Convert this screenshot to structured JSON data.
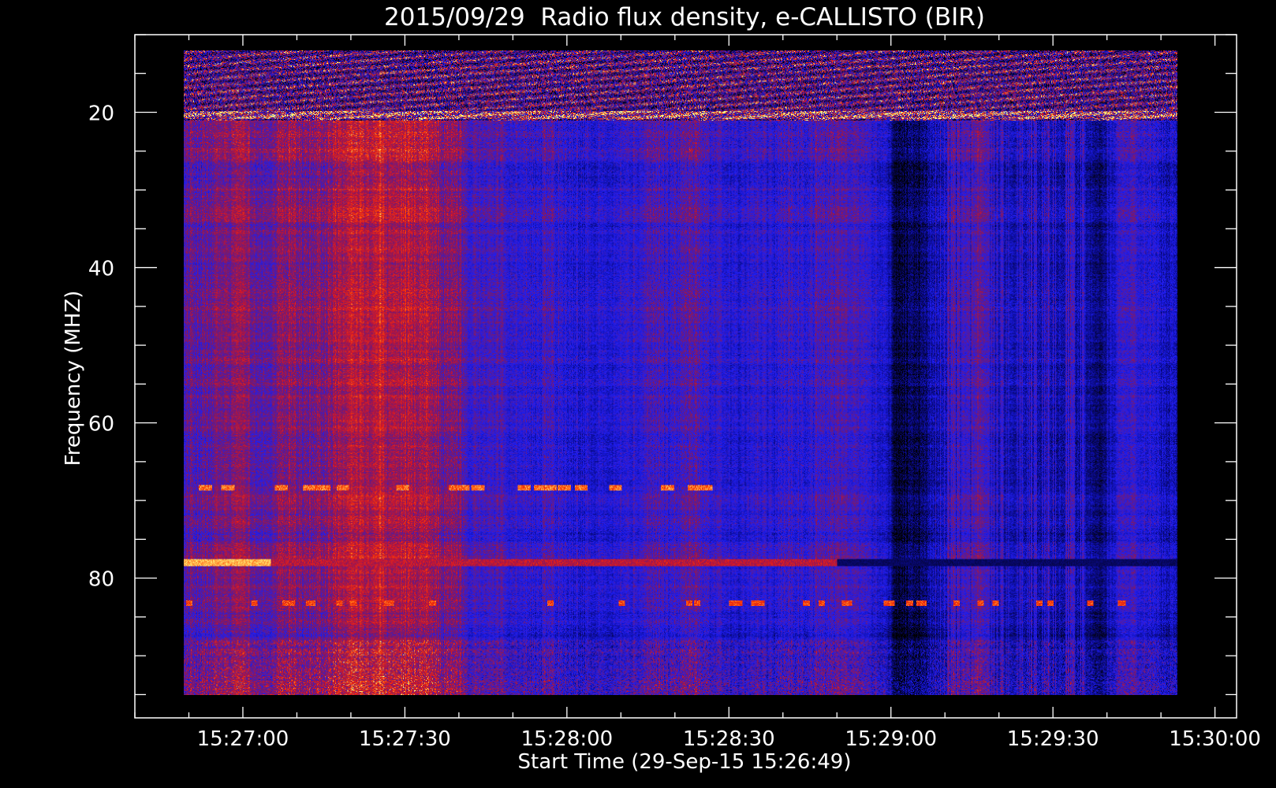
{
  "chart_data": {
    "type": "heatmap",
    "title": "2015/09/29  Radio flux density, e-CALLISTO (BIR)",
    "xlabel": "Start Time (29-Sep-15 15:26:49)",
    "ylabel": "Frequency (MHZ)",
    "x_tick_labels": [
      "15:27:00",
      "15:27:30",
      "15:28:00",
      "15:28:30",
      "15:29:00",
      "15:29:30",
      "15:30:00"
    ],
    "x_tick_seconds": [
      0,
      30,
      60,
      90,
      120,
      150,
      180
    ],
    "x_minor_step_seconds": 10,
    "xlim_seconds": [
      -20,
      184
    ],
    "data_x_range_seconds": [
      -11,
      173
    ],
    "y_tick_labels": [
      "20",
      "40",
      "60",
      "80"
    ],
    "y_tick_values": [
      20,
      40,
      60,
      80
    ],
    "y_minor_step": 5,
    "ylim": [
      10,
      98
    ],
    "data_y_range": [
      12,
      95
    ],
    "y_inverted": true,
    "colormap": [
      "#000000",
      "#0000ff",
      "#7a1a5a",
      "#ff0000",
      "#ffff66"
    ],
    "features": [
      {
        "kind": "band",
        "label": "bright band near 78 MHz",
        "y": 78,
        "x_start": -11,
        "x_end": 173
      },
      {
        "kind": "dots",
        "label": "intermittent emission near 68 MHz",
        "y": 68
      },
      {
        "kind": "dots",
        "label": "intermittent emission near 83 MHz",
        "y": 83
      },
      {
        "kind": "region",
        "label": "high intensity noise 12-21 MHz",
        "y_start": 12,
        "y_end": 21
      }
    ]
  }
}
